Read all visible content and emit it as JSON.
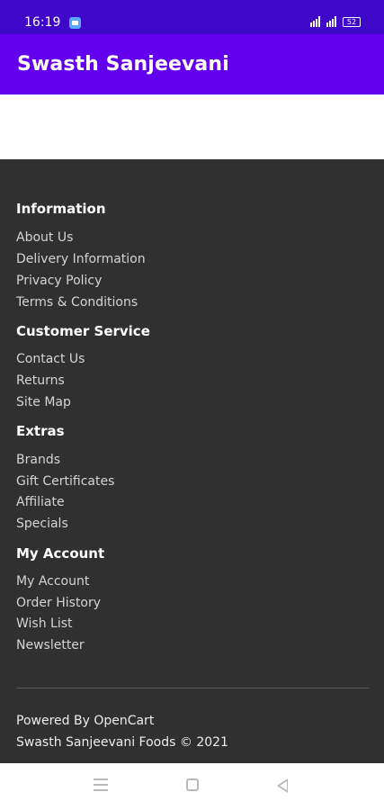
{
  "status_bar": {
    "time": "16:19",
    "battery": "52"
  },
  "app_bar": {
    "title": "Swasth Sanjeevani"
  },
  "footer": {
    "sections": [
      {
        "title": "Information",
        "links": [
          "About Us",
          "Delivery Information",
          "Privacy Policy",
          "Terms & Conditions"
        ]
      },
      {
        "title": "Customer Service",
        "links": [
          "Contact Us",
          "Returns",
          "Site Map"
        ]
      },
      {
        "title": "Extras",
        "links": [
          "Brands",
          "Gift Certificates",
          "Affiliate",
          "Specials"
        ]
      },
      {
        "title": "My Account",
        "links": [
          "My Account",
          "Order History",
          "Wish List",
          "Newsletter"
        ]
      }
    ],
    "powered_by_prefix": "Powered By ",
    "powered_by_link": "OpenCart",
    "copyright": "Swasth Sanjeevani Foods © 2021"
  },
  "colors": {
    "status_bar": "#3f08c8",
    "app_bar": "#6200ee",
    "footer_bg": "#303030"
  },
  "icons": {
    "notification": "image-notification-icon",
    "signal": "signal-icon",
    "battery": "battery-icon",
    "nav_menu": "recent-apps-icon",
    "nav_home": "home-icon",
    "nav_back": "back-icon"
  }
}
